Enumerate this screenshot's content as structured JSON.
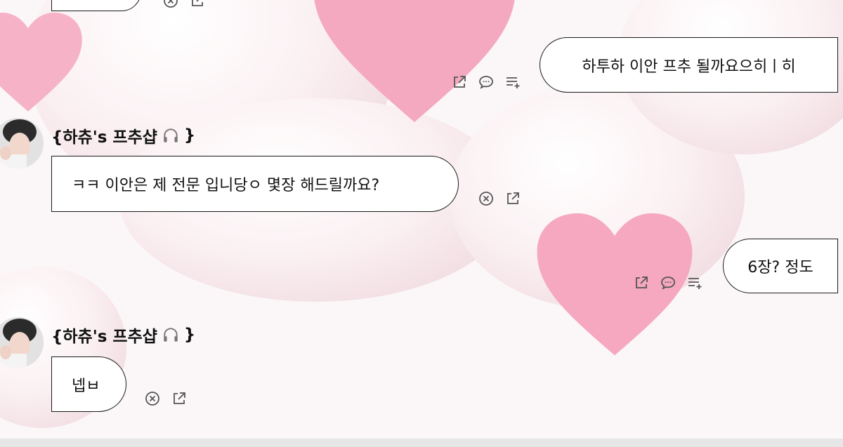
{
  "colors": {
    "background": "#fbf7f8",
    "heart_pink": "#f4a9c1",
    "bubble_border": "#1a1a1a",
    "icon_gray": "#555555"
  },
  "messages": [
    {
      "id": "m0",
      "direction": "incoming",
      "text": ""
    },
    {
      "id": "m1",
      "direction": "outgoing",
      "text": "하투하 이안 프추 될까요으히ㅣ히"
    },
    {
      "id": "m2",
      "direction": "incoming",
      "sender": "{하츄's 프추샵",
      "sender_close": "}",
      "sender_icon": "headphones-icon",
      "text": "ㅋㅋ 이안은 제 전문 입니당ㅇ 몇장 해드릴까요?"
    },
    {
      "id": "m3",
      "direction": "outgoing",
      "text": "6장? 정도"
    },
    {
      "id": "m4",
      "direction": "incoming",
      "sender": "{하츄's 프추샵",
      "sender_close": "}",
      "sender_icon": "headphones-icon",
      "text": "넵ㅂ"
    }
  ],
  "icons": {
    "incoming": [
      "close-circle-icon",
      "share-icon"
    ],
    "outgoing": [
      "share-icon",
      "comment-icon",
      "playlist-add-icon"
    ]
  }
}
